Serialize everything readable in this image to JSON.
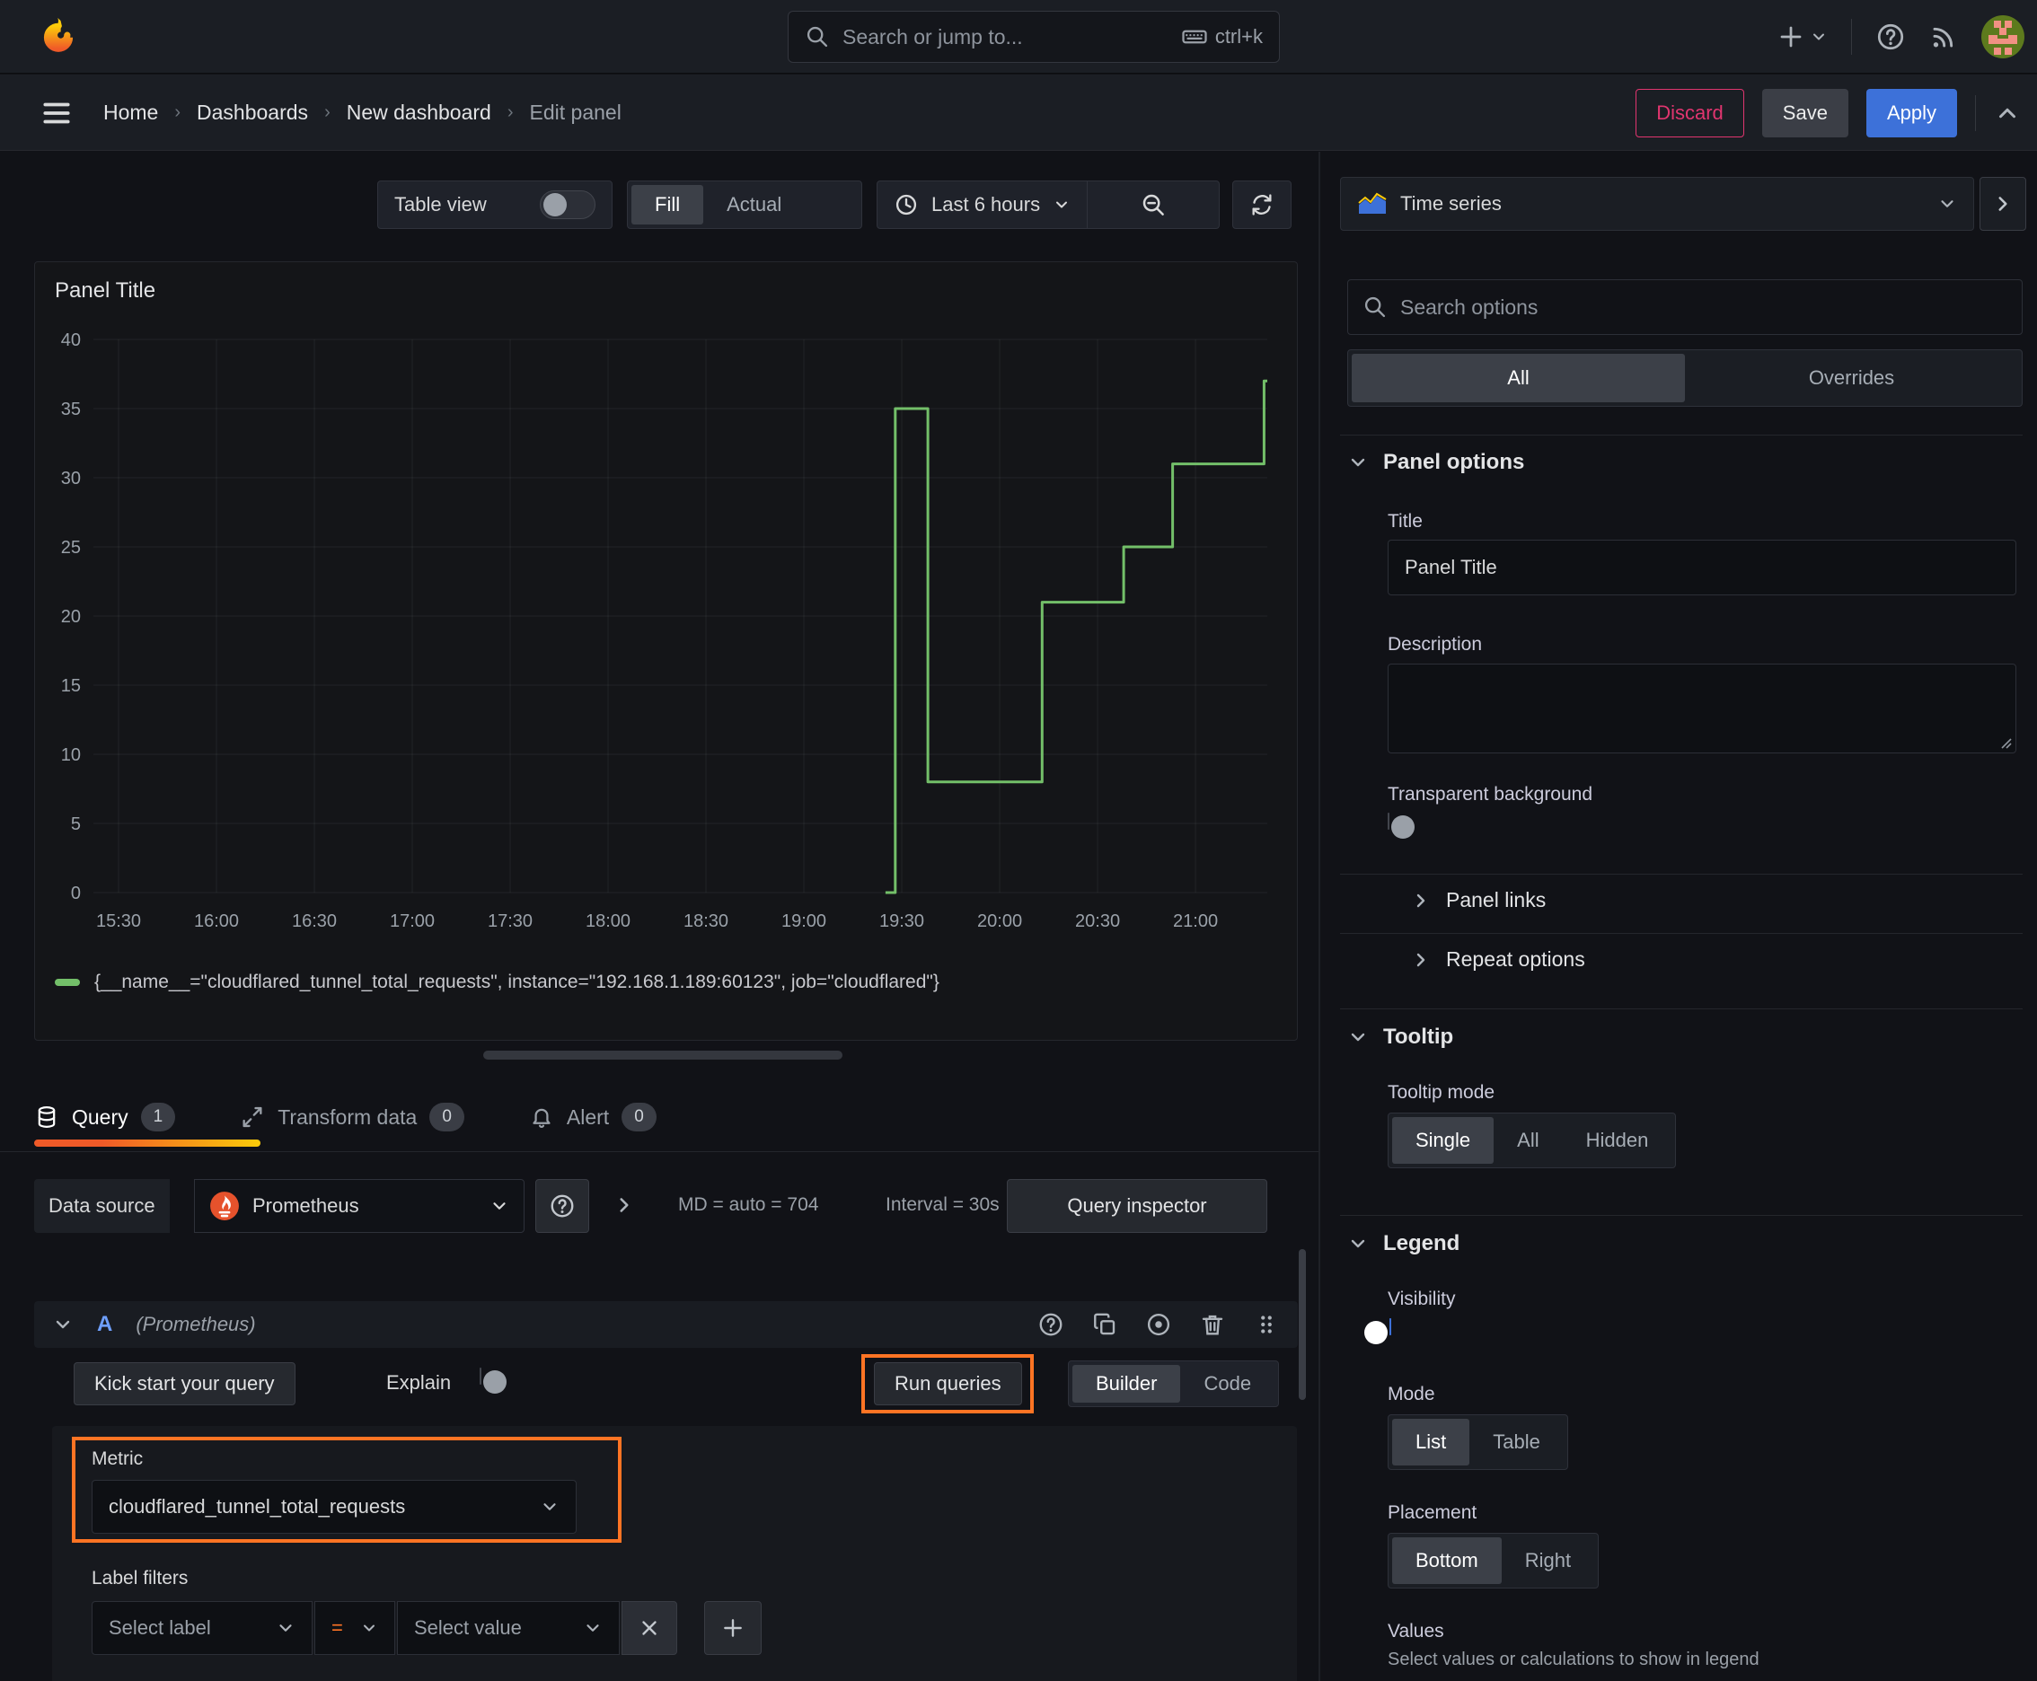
{
  "topbar": {
    "search_placeholder": "Search or jump to...",
    "shortcut": "ctrl+k"
  },
  "breadcrumb": {
    "items": [
      "Home",
      "Dashboards",
      "New dashboard",
      "Edit panel"
    ]
  },
  "actions": {
    "discard": "Discard",
    "save": "Save",
    "apply": "Apply"
  },
  "toolbar": {
    "table_view": "Table view",
    "fill": "Fill",
    "actual": "Actual",
    "time_range": "Last 6 hours"
  },
  "viz_picker": {
    "value": "Time series"
  },
  "panel": {
    "title": "Panel Title"
  },
  "chart_data": {
    "type": "line",
    "step": true,
    "title": "Panel Title",
    "xlabel": "",
    "ylabel": "",
    "ylim": [
      0,
      40
    ],
    "y_ticks": [
      0,
      5,
      10,
      15,
      20,
      25,
      30,
      35,
      40
    ],
    "x_ticks": [
      "15:30",
      "16:00",
      "16:30",
      "17:00",
      "17:30",
      "18:00",
      "18:30",
      "19:00",
      "19:30",
      "20:00",
      "20:30",
      "21:00"
    ],
    "x_start": "15:30",
    "x_end": "21:22",
    "grid": true,
    "legend_position": "bottom",
    "series": [
      {
        "name": "{__name__=\"cloudflared_tunnel_total_requests\", instance=\"192.168.1.189:60123\", job=\"cloudflared\"}",
        "color": "#73bf69",
        "points": [
          [
            "19:25",
            0
          ],
          [
            "19:28",
            0
          ],
          [
            "19:28",
            35
          ],
          [
            "19:38",
            35
          ],
          [
            "19:38",
            8
          ],
          [
            "20:13",
            8
          ],
          [
            "20:13",
            21
          ],
          [
            "20:38",
            21
          ],
          [
            "20:38",
            25
          ],
          [
            "20:53",
            25
          ],
          [
            "20:53",
            31
          ],
          [
            "21:21",
            31
          ],
          [
            "21:21",
            37
          ],
          [
            "21:22",
            37
          ]
        ]
      }
    ]
  },
  "tabs": {
    "query": "Query",
    "query_count": "1",
    "transform": "Transform data",
    "transform_count": "0",
    "alert": "Alert",
    "alert_count": "0"
  },
  "datasource": {
    "label": "Data source",
    "name": "Prometheus",
    "md_stat": "MD = auto = 704",
    "interval_stat": "Interval = 30s",
    "inspector": "Query inspector"
  },
  "query": {
    "ref_id": "A",
    "ds_hint": "(Prometheus)",
    "kick_start": "Kick start your query",
    "explain": "Explain",
    "run": "Run queries",
    "builder": "Builder",
    "code": "Code",
    "metric_label": "Metric",
    "metric_value": "cloudflared_tunnel_total_requests",
    "filters_label": "Label filters",
    "select_label": "Select label",
    "operator": "=",
    "select_value": "Select value"
  },
  "options": {
    "search_placeholder": "Search options",
    "tab_all": "All",
    "tab_overrides": "Overrides",
    "panel_options": {
      "header": "Panel options",
      "title_label": "Title",
      "title_value": "Panel Title",
      "description_label": "Description",
      "transparent_label": "Transparent background"
    },
    "panel_links": "Panel links",
    "repeat_options": "Repeat options",
    "tooltip": {
      "header": "Tooltip",
      "mode_label": "Tooltip mode",
      "single": "Single",
      "all": "All",
      "hidden": "Hidden"
    },
    "legend": {
      "header": "Legend",
      "visibility_label": "Visibility",
      "mode_label": "Mode",
      "list": "List",
      "table": "Table",
      "placement_label": "Placement",
      "bottom": "Bottom",
      "right": "Right",
      "values_label": "Values",
      "values_hint": "Select values or calculations to show in legend"
    }
  },
  "colors": {
    "accent": "#ff7424",
    "green": "#73bf69",
    "blue": "#3d71d9",
    "pink": "#e0356f"
  }
}
